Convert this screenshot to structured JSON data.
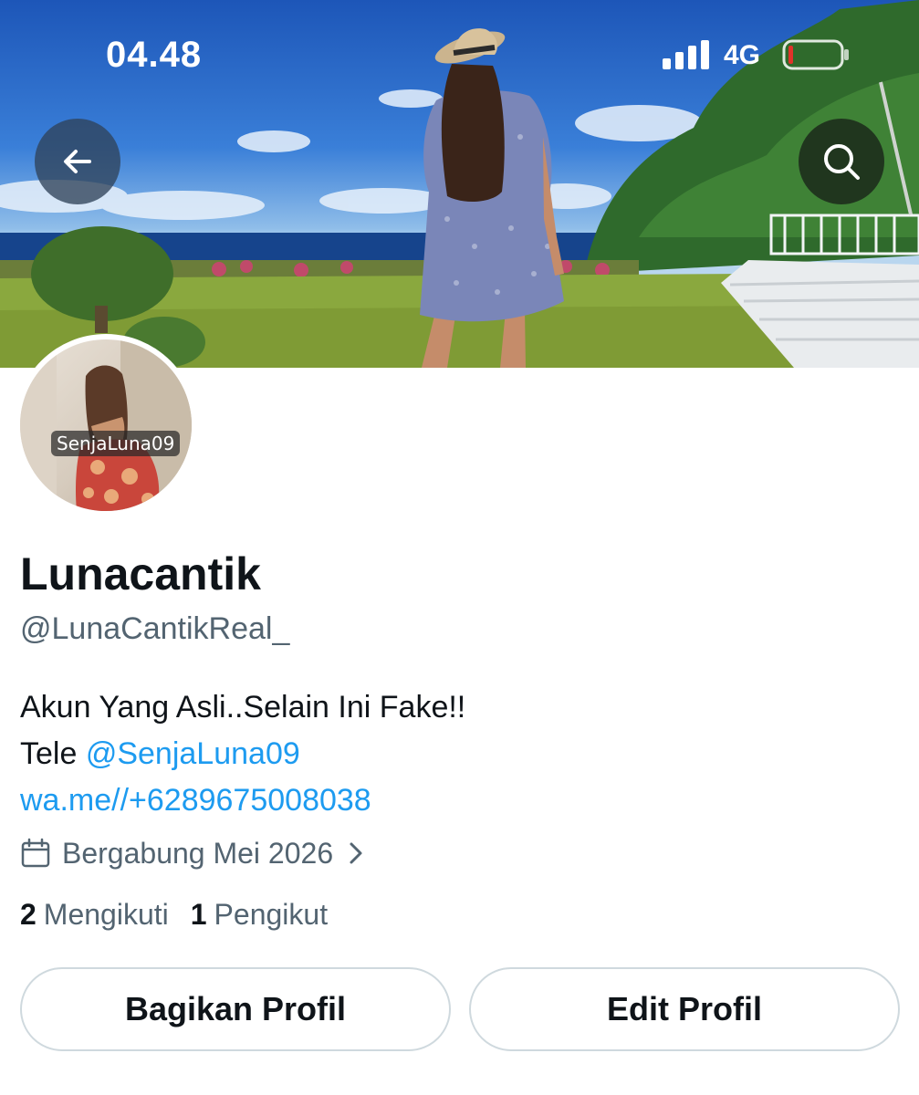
{
  "status_bar": {
    "time": "04.48",
    "network": "4G",
    "signal_icon": "signal-bars-icon",
    "battery_icon": "battery-low-icon",
    "battery_color": "#e0332a"
  },
  "header": {
    "back_icon": "arrow-left-icon",
    "search_icon": "search-icon"
  },
  "avatar": {
    "watermark": "SenjaLuna09"
  },
  "profile": {
    "display_name": "Lunacantik",
    "handle": "@LunaCantikReal_",
    "bio_line1": "Akun Yang Asli..Selain Ini Fake!!",
    "bio_line2_prefix": "Tele ",
    "bio_line2_link": "@SenjaLuna09",
    "bio_line3_link": "wa.me//+6289675008038",
    "joined": "Bergabung Mei 2026",
    "joined_icon": "calendar-icon"
  },
  "stats": {
    "following_count": "2",
    "following_label": "Mengikuti",
    "followers_count": "1",
    "followers_label": "Pengikut"
  },
  "actions": {
    "share_label": "Bagikan Profil",
    "edit_label": "Edit Profil"
  },
  "colors": {
    "link": "#1d9bf0",
    "secondary_text": "#536471",
    "primary_text": "#0f1419",
    "button_border": "#cfd9de"
  }
}
